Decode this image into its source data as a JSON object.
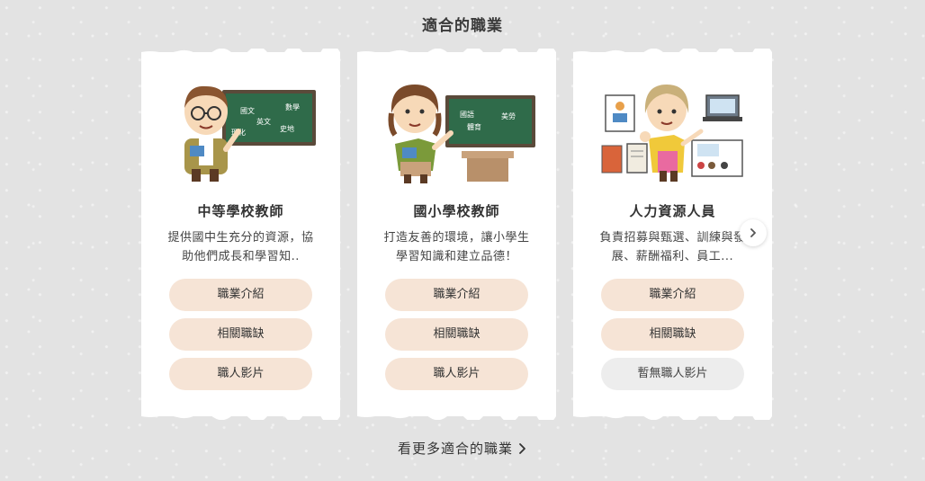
{
  "section": {
    "title": "適合的職業"
  },
  "cards": [
    {
      "title": "中等學校教師",
      "description": "提供國中生充分的資源，協助他們成長和學習知..",
      "illustration": "secondary-teacher-illustration",
      "board_text": [
        "國文",
        "數學",
        "英文",
        "理化",
        "史地"
      ],
      "buttons": {
        "intro": "職業介紹",
        "jobs": "相關職缺",
        "video": "職人影片"
      }
    },
    {
      "title": "國小學校教師",
      "description": "打造友善的環境，讓小學生學習知識和建立品德！",
      "illustration": "primary-teacher-illustration",
      "board_text": [
        "國語",
        "體育",
        "美勞"
      ],
      "buttons": {
        "intro": "職業介紹",
        "jobs": "相關職缺",
        "video": "職人影片"
      }
    },
    {
      "title": "人力資源人員",
      "description": "負責招募與甄選、訓練與發展、薪酬福利、員工...",
      "illustration": "hr-staff-illustration",
      "buttons": {
        "intro": "職業介紹",
        "jobs": "相關職缺",
        "video": "暫無職人影片"
      }
    }
  ],
  "carousel": {
    "next_icon": "chevron-right-icon"
  },
  "see_more": {
    "label": "看更多適合的職業",
    "icon": "chevron-right-icon"
  },
  "colors": {
    "pill": "#f6e4d6",
    "pill_disabled": "#ededed",
    "background": "#e3e3e3"
  }
}
